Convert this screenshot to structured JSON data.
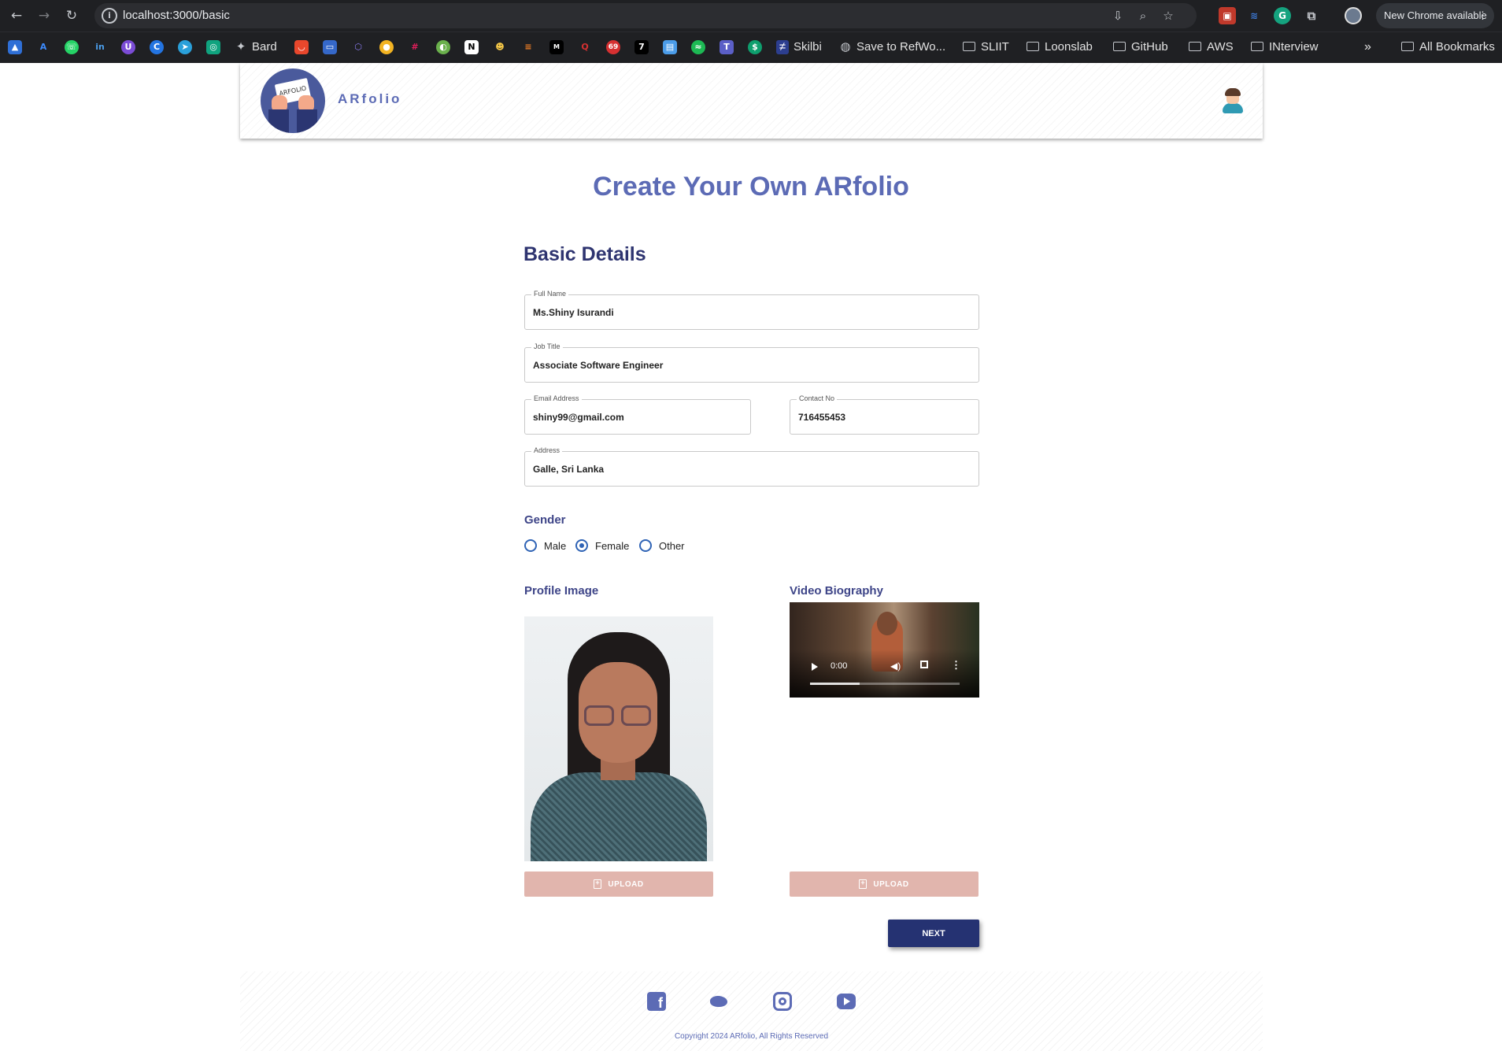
{
  "browser": {
    "url": "localhost:3000/basic",
    "update_label": "New Chrome available",
    "bookmarks": [
      {
        "label": "Bard"
      },
      {
        "label": "Skilbi"
      },
      {
        "label": "Save to RefWo..."
      },
      {
        "label": "SLIIT"
      },
      {
        "label": "Loonslab"
      },
      {
        "label": "GitHub"
      },
      {
        "label": "AWS"
      },
      {
        "label": "INterview"
      }
    ],
    "all_bookmarks_label": "All Bookmarks",
    "more_label": "»"
  },
  "header": {
    "brand": "ARfolio",
    "logo_text": "ARFOLIO"
  },
  "page": {
    "title": "Create Your Own ARfolio",
    "section_title": "Basic Details"
  },
  "form": {
    "full_name": {
      "label": "Full Name",
      "value": "Ms.Shiny Isurandi"
    },
    "job_title": {
      "label": "Job Title",
      "value": "Associate Software Engineer"
    },
    "email": {
      "label": "Email Address",
      "value": "shiny99@gmail.com"
    },
    "contact": {
      "label": "Contact No",
      "value": "716455453"
    },
    "address": {
      "label": "Address",
      "value": "Galle, Sri Lanka"
    },
    "gender": {
      "label": "Gender",
      "options": [
        {
          "label": "Male",
          "checked": false
        },
        {
          "label": "Female",
          "checked": true
        },
        {
          "label": "Other",
          "checked": false
        }
      ]
    },
    "profile_image_label": "Profile Image",
    "video_label": "Video Biography",
    "video_time": "0:00",
    "video_progress": 0.33,
    "upload_label": "UPLOAD",
    "next_label": "NEXT"
  },
  "footer": {
    "copyright": "Copyright 2024 ARfolio, All Rights Reserved"
  },
  "colors": {
    "brand": "#5c6bb5",
    "navy": "#253272",
    "upload": "#e1b5ad",
    "radio": "#2f63b5"
  }
}
